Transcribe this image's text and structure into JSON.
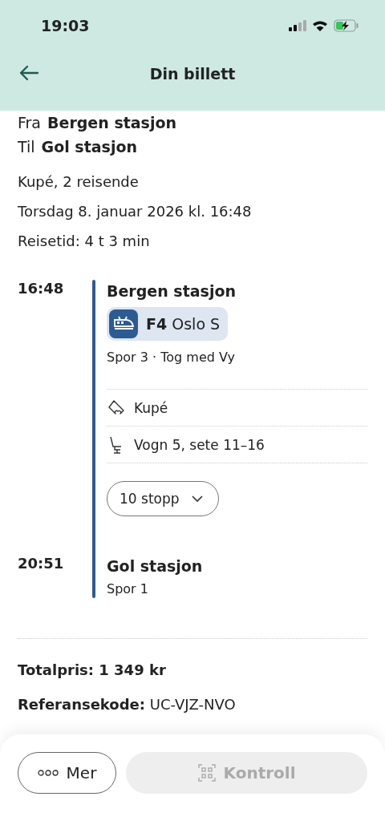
{
  "status_bar": {
    "time": "19:03"
  },
  "header": {
    "title": "Din billett"
  },
  "route": [
    {
      "label": "Fra",
      "station": "Bergen stasjon"
    },
    {
      "label": "Til",
      "station": "Gol stasjon"
    }
  ],
  "details": [
    "Kupé, 2 reisende",
    "Torsdag 8. januar 2026 kl. 16:48",
    "Reisetid: 4 t 3 min"
  ],
  "journey": {
    "departure": {
      "time": "16:48",
      "station": "Bergen stasjon"
    },
    "line": {
      "code": "F4",
      "destination": "Oslo S"
    },
    "info": "Spor 3 · Tog med Vy",
    "features": [
      {
        "kind": "ticket",
        "text": "Kupé"
      },
      {
        "kind": "seat",
        "text": "Vogn 5, sete 11–16"
      }
    ],
    "stops_button": "10 stopp",
    "arrival": {
      "time": "20:51",
      "station": "Gol stasjon",
      "info": "Spor 1"
    }
  },
  "total": "Totalpris: 1 349 kr",
  "reference": "**Referansekode:** UC-VJZ-NVO",
  "buttons": [
    {
      "kind": "more",
      "label": "Mer",
      "disabled": false
    },
    {
      "kind": "qr",
      "label": "Kontroll",
      "disabled": true
    }
  ]
}
